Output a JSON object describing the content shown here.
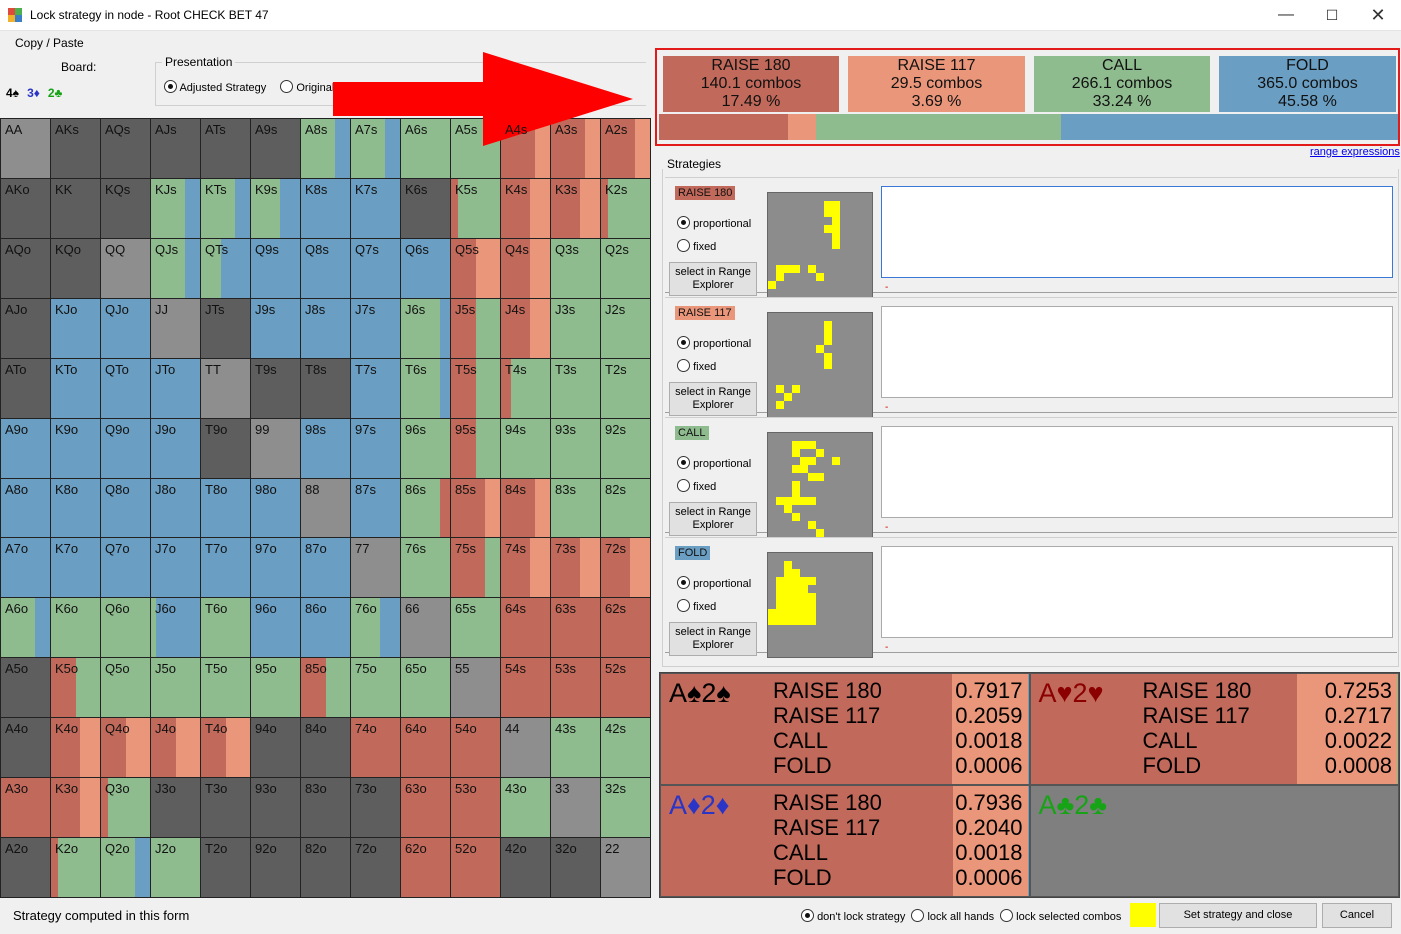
{
  "window": {
    "title": "Lock strategy in node  - Root CHECK BET 47",
    "minimize_icon": "minimize-icon",
    "maximize_icon": "maximize-icon",
    "close_icon": "close-icon"
  },
  "menu": {
    "copy_paste": "Copy / Paste"
  },
  "board": {
    "label": "Board:",
    "cards": [
      {
        "text": "4♠",
        "color": "#000000"
      },
      {
        "text": "3♦",
        "color": "#2a35c8"
      },
      {
        "text": "2♣",
        "color": "#16a316"
      }
    ]
  },
  "presentation": {
    "legend": "Presentation",
    "options": [
      {
        "label": "Adjusted Strategy",
        "selected": true
      },
      {
        "label": "Original",
        "selected": false
      }
    ]
  },
  "colors": {
    "raise180": "#c1695a",
    "raise117": "#e9967a",
    "call": "#8fbc8f",
    "fold": "#6a9ec2",
    "empty": "#5e5e5e",
    "pair_empty": "#8e8e8e",
    "highlight": "#ffff00"
  },
  "actions": [
    {
      "name": "RAISE 180",
      "combos": "140.1 combos",
      "pct": "17.49 %",
      "freq": 0.1749,
      "color": "#c1695a"
    },
    {
      "name": "RAISE 117",
      "combos": "29.5 combos",
      "pct": "3.69 %",
      "freq": 0.0369,
      "color": "#e9967a"
    },
    {
      "name": "CALL",
      "combos": "266.1 combos",
      "pct": "33.24 %",
      "freq": 0.3324,
      "color": "#8fbc8f"
    },
    {
      "name": "FOLD",
      "combos": "365.0 combos",
      "pct": "45.58 %",
      "freq": 0.4558,
      "color": "#6a9ec2"
    }
  ],
  "range_link": "range expressions",
  "strategies_legend": "Strategies",
  "strategy_rows": [
    {
      "badge": "RAISE 180",
      "color": "#c1695a"
    },
    {
      "badge": "RAISE 117",
      "color": "#e9967a"
    },
    {
      "badge": "CALL",
      "color": "#8fbc8f"
    },
    {
      "badge": "FOLD",
      "color": "#6a9ec2"
    }
  ],
  "strategy_option_labels": {
    "proportional": "proportional",
    "fixed": "fixed",
    "select_line1": "select in Range",
    "select_line2": "Explorer",
    "dash": "-"
  },
  "grid": {
    "rows": [
      [
        "AA",
        "AKs",
        "AQs",
        "AJs",
        "ATs",
        "A9s",
        "A8s",
        "A7s",
        "A6s",
        "A5s",
        "A4s",
        "A3s",
        "A2s"
      ],
      [
        "AKo",
        "KK",
        "KQs",
        "KJs",
        "KTs",
        "K9s",
        "K8s",
        "K7s",
        "K6s",
        "K5s",
        "K4s",
        "K3s",
        "K2s"
      ],
      [
        "AQo",
        "KQo",
        "QQ",
        "QJs",
        "QTs",
        "Q9s",
        "Q8s",
        "Q7s",
        "Q6s",
        "Q5s",
        "Q4s",
        "Q3s",
        "Q2s"
      ],
      [
        "AJo",
        "KJo",
        "QJo",
        "JJ",
        "JTs",
        "J9s",
        "J8s",
        "J7s",
        "J6s",
        "J5s",
        "J4s",
        "J3s",
        "J2s"
      ],
      [
        "ATo",
        "KTo",
        "QTo",
        "JTo",
        "TT",
        "T9s",
        "T8s",
        "T7s",
        "T6s",
        "T5s",
        "T4s",
        "T3s",
        "T2s"
      ],
      [
        "A9o",
        "K9o",
        "Q9o",
        "J9o",
        "T9o",
        "99",
        "98s",
        "97s",
        "96s",
        "95s",
        "94s",
        "93s",
        "92s"
      ],
      [
        "A8o",
        "K8o",
        "Q8o",
        "J8o",
        "T8o",
        "98o",
        "88",
        "87s",
        "86s",
        "85s",
        "84s",
        "83s",
        "82s"
      ],
      [
        "A7o",
        "K7o",
        "Q7o",
        "J7o",
        "T7o",
        "97o",
        "87o",
        "77",
        "76s",
        "75s",
        "74s",
        "73s",
        "72s"
      ],
      [
        "A6o",
        "K6o",
        "Q6o",
        "J6o",
        "T6o",
        "96o",
        "86o",
        "76o",
        "66",
        "65s",
        "64s",
        "63s",
        "62s"
      ],
      [
        "A5o",
        "K5o",
        "Q5o",
        "J5o",
        "T5o",
        "95o",
        "85o",
        "75o",
        "65o",
        "55",
        "54s",
        "53s",
        "52s"
      ],
      [
        "A4o",
        "K4o",
        "Q4o",
        "J4o",
        "T4o",
        "94o",
        "84o",
        "74o",
        "64o",
        "54o",
        "44",
        "43s",
        "42s"
      ],
      [
        "A3o",
        "K3o",
        "Q3o",
        "J3o",
        "T3o",
        "93o",
        "83o",
        "73o",
        "63o",
        "53o",
        "43o",
        "33",
        "32s"
      ],
      [
        "A2o",
        "K2o",
        "Q2o",
        "J2o",
        "T2o",
        "92o",
        "82o",
        "72o",
        "62o",
        "52o",
        "42o",
        "32o",
        "22"
      ]
    ]
  },
  "combos": [
    {
      "hand": "A♠2♠",
      "hand_color": "#000000",
      "actions": [
        "RAISE 180",
        "RAISE 117",
        "CALL",
        "FOLD"
      ],
      "values": [
        "0.7917",
        "0.2059",
        "0.0018",
        "0.0006"
      ],
      "split": [
        0.7917,
        0.2059,
        0.0018,
        0.0006
      ]
    },
    {
      "hand": "A♥2♥",
      "hand_color": "#8b0000",
      "actions": [
        "RAISE 180",
        "RAISE 117",
        "CALL",
        "FOLD"
      ],
      "values": [
        "0.7253",
        "0.2717",
        "0.0022",
        "0.0008"
      ],
      "split": [
        0.7253,
        0.2717,
        0.0022,
        0.0008
      ]
    },
    {
      "hand": "A♦2♦",
      "hand_color": "#2a35c8",
      "actions": [
        "RAISE 180",
        "RAISE 117",
        "CALL",
        "FOLD"
      ],
      "values": [
        "0.7936",
        "0.2040",
        "0.0018",
        "0.0006"
      ],
      "split": [
        0.7936,
        0.204,
        0.0018,
        0.0006
      ]
    },
    {
      "hand": "A♣2♣",
      "hand_color": "#16a316",
      "actions": [],
      "values": [],
      "split": []
    }
  ],
  "status": {
    "text": "Strategy computed in this form",
    "lock_options": [
      {
        "label": "don't lock strategy",
        "selected": true
      },
      {
        "label": "lock all hands",
        "selected": false
      },
      {
        "label": "lock selected combos",
        "selected": false
      }
    ],
    "set_button": "Set strategy and close",
    "cancel_button": "Cancel"
  }
}
